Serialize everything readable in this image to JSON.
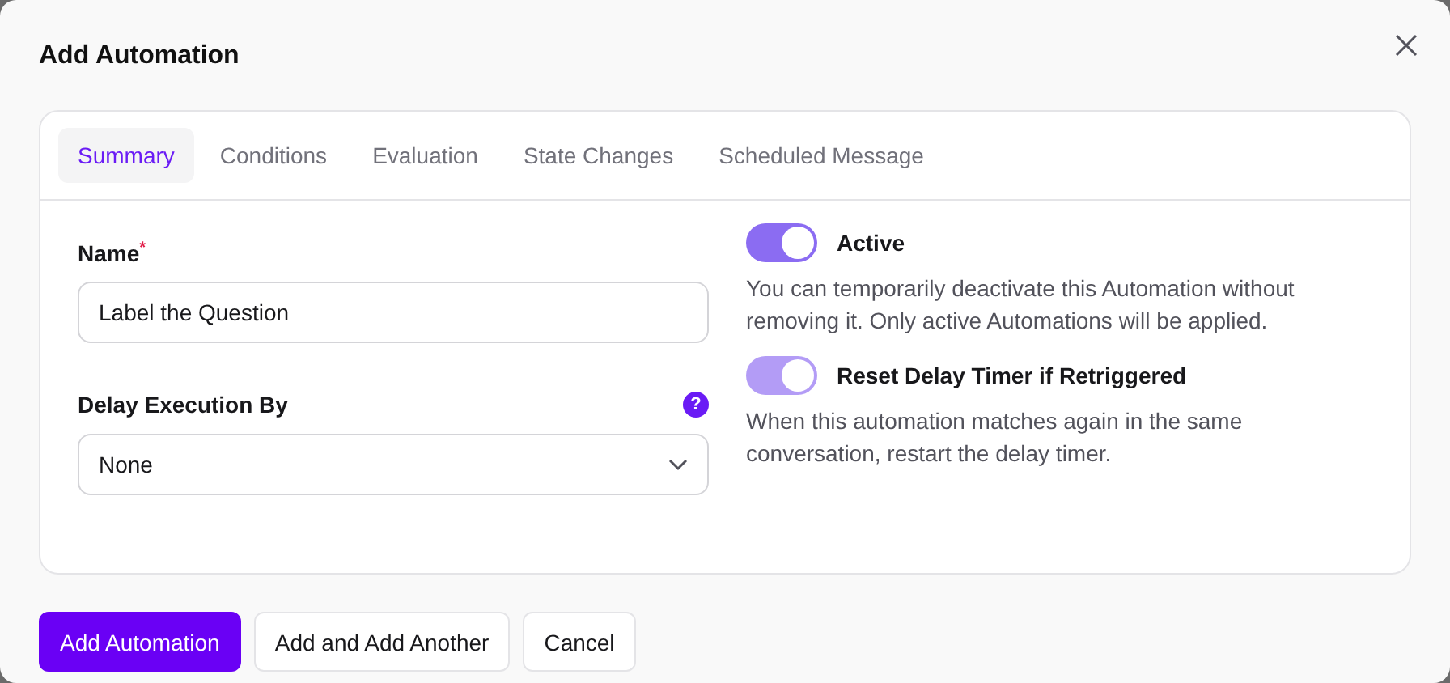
{
  "dialog": {
    "title": "Add Automation"
  },
  "tabs": [
    {
      "label": "Summary",
      "selected": true
    },
    {
      "label": "Conditions",
      "selected": false
    },
    {
      "label": "Evaluation",
      "selected": false
    },
    {
      "label": "State Changes",
      "selected": false
    },
    {
      "label": "Scheduled Message",
      "selected": false
    }
  ],
  "name_field": {
    "label": "Name",
    "required_mark": "*",
    "value": "Label the Question"
  },
  "delay_field": {
    "label": "Delay Execution By",
    "help_icon": "?",
    "value": "None"
  },
  "toggles": [
    {
      "label": "Active",
      "on": true,
      "disabled": false,
      "description": "You can temporarily deactivate this Automation without removing it. Only active Automations will be applied."
    },
    {
      "label": "Reset Delay Timer if Retriggered",
      "on": true,
      "disabled": true,
      "description": "When this automation matches again in the same conversation, restart the delay timer."
    }
  ],
  "buttons": [
    {
      "label": "Add Automation",
      "kind": "primary"
    },
    {
      "label": "Add and Add Another",
      "kind": "secondary"
    },
    {
      "label": "Cancel",
      "kind": "secondary"
    }
  ]
}
